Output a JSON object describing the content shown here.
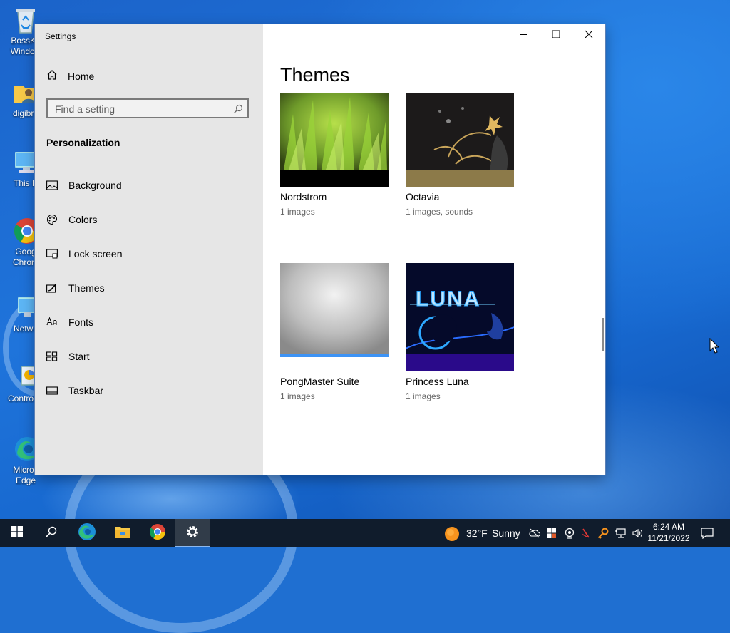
{
  "desktop": {
    "icons": [
      {
        "name": "recycle-bin",
        "line1": "BossKa",
        "line2": "Window"
      },
      {
        "name": "user-folder",
        "line1": "digibro",
        "line2": ""
      },
      {
        "name": "this-pc",
        "line1": "This P",
        "line2": ""
      },
      {
        "name": "google-chrome",
        "line1": "Goog",
        "line2": "Chrom"
      },
      {
        "name": "network",
        "line1": "Netwo",
        "line2": ""
      },
      {
        "name": "control-panel",
        "line1": "Control P",
        "line2": ""
      },
      {
        "name": "microsoft-edge",
        "line1": "Micros",
        "line2": "Edge"
      }
    ]
  },
  "window": {
    "title": "Settings",
    "controls": {
      "minimize": "minimize-icon",
      "maximize": "maximize-icon",
      "close": "close-icon"
    }
  },
  "sidebar": {
    "home_label": "Home",
    "search_placeholder": "Find a setting",
    "section_title": "Personalization",
    "items": [
      {
        "label": "Background",
        "icon": "picture-icon"
      },
      {
        "label": "Colors",
        "icon": "palette-icon"
      },
      {
        "label": "Lock screen",
        "icon": "lock-screen-icon"
      },
      {
        "label": "Themes",
        "icon": "brush-icon"
      },
      {
        "label": "Fonts",
        "icon": "fonts-icon"
      },
      {
        "label": "Start",
        "icon": "start-icon"
      },
      {
        "label": "Taskbar",
        "icon": "taskbar-icon"
      }
    ]
  },
  "main": {
    "title": "Themes",
    "themes": [
      {
        "name": "Nordstrom",
        "details": "1 images",
        "bar_color": "#000000"
      },
      {
        "name": "Octavia",
        "details": "1 images, sounds",
        "bar_color": "#8c7a49"
      },
      {
        "name": "PongMaster Suite",
        "details": "1 images",
        "bar_color": "#3d93f5"
      },
      {
        "name": "Princess Luna",
        "details": "1 images",
        "bar_color": "#2a0a8a"
      }
    ],
    "luna_logo_text": "LUNA"
  },
  "taskbar": {
    "weather": {
      "temp": "32°F",
      "condition": "Sunny"
    },
    "clock": {
      "time": "6:24 AM",
      "date": "11/21/2022"
    }
  },
  "colors": {
    "accent": "#0078d7",
    "sidebar_bg": "#e6e6e6",
    "taskbar_bg": "#101c2c"
  }
}
